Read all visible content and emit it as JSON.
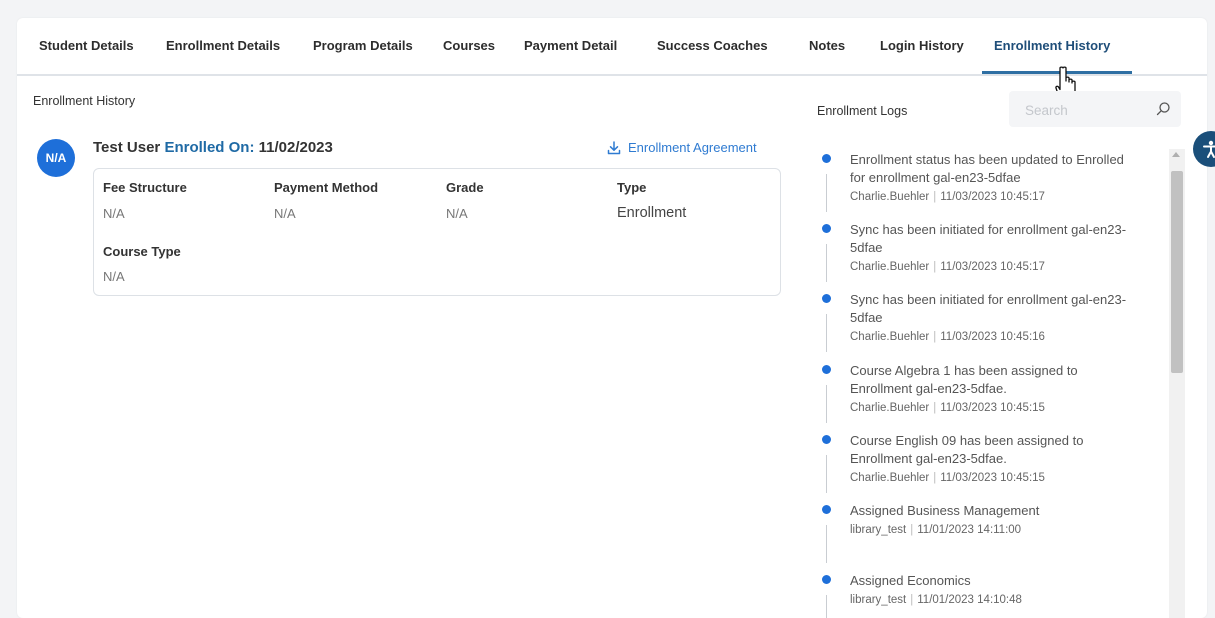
{
  "tabs": [
    {
      "label": "Student Details"
    },
    {
      "label": "Enrollment Details"
    },
    {
      "label": "Program Details"
    },
    {
      "label": "Courses"
    },
    {
      "label": "Payment Detail"
    },
    {
      "label": "Success Coaches"
    },
    {
      "label": "Notes"
    },
    {
      "label": "Login History"
    },
    {
      "label": "Enrollment History",
      "active": true
    }
  ],
  "section_title": "Enrollment History",
  "enrollment": {
    "avatar": "N/A",
    "user": "Test User",
    "enrolled_on_label": "Enrolled On:",
    "date": "11/02/2023",
    "agreement_label": "Enrollment Agreement",
    "fields": [
      {
        "label": "Fee Structure",
        "value": "N/A"
      },
      {
        "label": "Payment Method",
        "value": "N/A"
      },
      {
        "label": "Grade",
        "value": "N/A"
      },
      {
        "label": "Type",
        "value": "Enrollment"
      },
      {
        "label": "Course Type",
        "value": "N/A"
      }
    ]
  },
  "logs_panel": {
    "title": "Enrollment Logs",
    "search_placeholder": "Search",
    "entries": [
      {
        "message": "Enrollment status has been updated to Enrolled for enrollment gal-en23-5dfae",
        "user": "Charlie.Buehler",
        "timestamp": "11/03/2023 10:45:17"
      },
      {
        "message": "Sync has been initiated for enrollment gal-en23-5dfae",
        "user": "Charlie.Buehler",
        "timestamp": "11/03/2023 10:45:17"
      },
      {
        "message": "Sync has been initiated for enrollment gal-en23-5dfae",
        "user": "Charlie.Buehler",
        "timestamp": "11/03/2023 10:45:16"
      },
      {
        "message": "Course Algebra 1 has been assigned to Enrollment gal-en23-5dfae.",
        "user": "Charlie.Buehler",
        "timestamp": "11/03/2023 10:45:15"
      },
      {
        "message": "Course English 09 has been assigned to Enrollment gal-en23-5dfae.",
        "user": "Charlie.Buehler",
        "timestamp": "11/03/2023 10:45:15"
      },
      {
        "message": "Assigned Business Management",
        "user": "library_test",
        "timestamp": "11/01/2023 14:11:00"
      },
      {
        "message": "Assigned Economics",
        "user": "library_test",
        "timestamp": "11/01/2023 14:10:48"
      }
    ]
  },
  "colors": {
    "accent": "#1f6aa5",
    "link": "#2f7bd1",
    "dot": "#1e6fd9",
    "avatar": "#1e6fd9"
  }
}
